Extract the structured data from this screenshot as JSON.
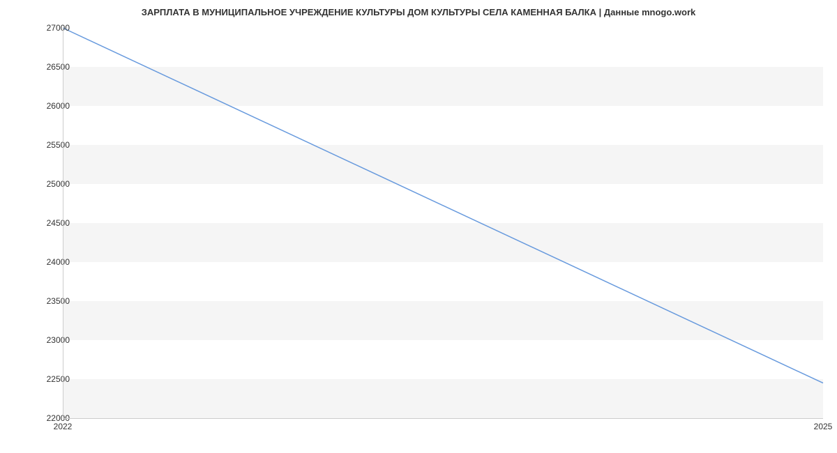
{
  "chart_data": {
    "type": "line",
    "title": "ЗАРПЛАТА В МУНИЦИПАЛЬНОЕ УЧРЕЖДЕНИЕ КУЛЬТУРЫ ДОМ КУЛЬТУРЫ СЕЛА КАМЕННАЯ БАЛКА | Данные mnogo.work",
    "x": [
      2022,
      2025
    ],
    "values": [
      27000,
      22450
    ],
    "xlabel": "",
    "ylabel": "",
    "xlim": [
      2022,
      2025
    ],
    "ylim": [
      22000,
      27000
    ],
    "x_ticks": [
      2022,
      2025
    ],
    "y_ticks": [
      22000,
      22500,
      23000,
      23500,
      24000,
      24500,
      25000,
      25500,
      26000,
      26500,
      27000
    ],
    "line_color": "#6699dd"
  }
}
